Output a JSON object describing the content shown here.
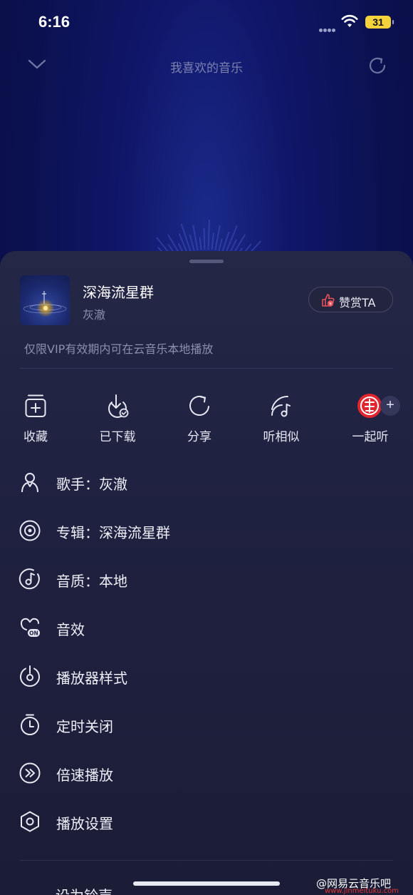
{
  "status_bar": {
    "time": "6:16",
    "battery": "31"
  },
  "top_nav": {
    "title": "我喜欢的音乐"
  },
  "song": {
    "title": "深海流星群",
    "artist": "灰澈"
  },
  "tip_button": {
    "label": "赞赏TA"
  },
  "vip_note": "仅限VIP有效期内可在云音乐本地播放",
  "actions": [
    {
      "label": "收藏",
      "icon": "add-collection-icon"
    },
    {
      "label": "已下载",
      "icon": "downloaded-icon"
    },
    {
      "label": "分享",
      "icon": "share-icon"
    },
    {
      "label": "听相似",
      "icon": "similar-icon"
    },
    {
      "label": "一起听",
      "icon": "listen-together-icon"
    }
  ],
  "menu": [
    {
      "label": "歌手：灰澈",
      "icon": "singer-icon"
    },
    {
      "label": "专辑：深海流星群",
      "icon": "album-icon"
    },
    {
      "label": "音质：本地",
      "icon": "quality-icon"
    },
    {
      "label": "音效",
      "icon": "sound-effect-icon"
    },
    {
      "label": "播放器样式",
      "icon": "player-style-icon"
    },
    {
      "label": "定时关闭",
      "icon": "timer-icon"
    },
    {
      "label": "倍速播放",
      "icon": "speed-icon"
    },
    {
      "label": "播放设置",
      "icon": "settings-icon"
    }
  ],
  "partial_item": {
    "label": "设为铃声"
  },
  "watermark": {
    "text": "@网易云音乐吧",
    "url": "www.jinmeituku.com"
  },
  "colors": {
    "background": "#0d1350",
    "sheet": "#1f2140",
    "accent_red": "#e0262e",
    "battery": "#f4d23b"
  }
}
